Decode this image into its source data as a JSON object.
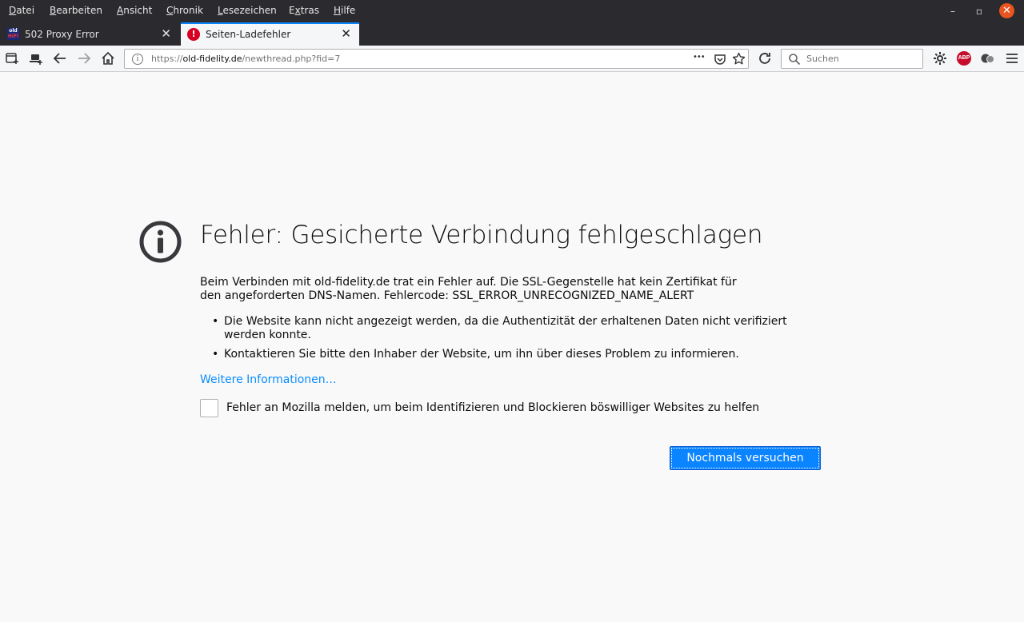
{
  "menubar": {
    "items": [
      {
        "label": "Datei",
        "accel": "D",
        "rest": "atei"
      },
      {
        "label": "Bearbeiten",
        "accel": "B",
        "rest": "earbeiten"
      },
      {
        "label": "Ansicht",
        "accel": "A",
        "rest": "nsicht"
      },
      {
        "label": "Chronik",
        "accel": "C",
        "rest": "hronik"
      },
      {
        "label": "Lesezeichen",
        "accel": "L",
        "rest": "esezeichen"
      },
      {
        "label": "Extras",
        "accel": "x",
        "rest": "tras",
        "prefix": "E"
      },
      {
        "label": "Hilfe",
        "accel": "H",
        "rest": "ilfe"
      }
    ]
  },
  "window_controls": {
    "minimize": "–",
    "restore": "▫",
    "close": "✕"
  },
  "tabs": [
    {
      "title": "502 Proxy Error",
      "favicon_top": "old",
      "favicon_bottom": "HiFi",
      "close": "✕"
    },
    {
      "title": "Seiten-Ladefehler",
      "favicon": "!",
      "close": "✕",
      "active": true
    }
  ],
  "urlbar": {
    "scheme": "https://",
    "host": "old-fidelity.de",
    "path": "/newthread.php?fid=7",
    "info_glyph": "i",
    "page_actions": "•••"
  },
  "searchbar": {
    "placeholder": "Suchen"
  },
  "extensions": {
    "abp_label": "ABP"
  },
  "content": {
    "title": "Fehler: Gesicherte Verbindung fehlgeschlagen",
    "description": "Beim Verbinden mit old-fidelity.de trat ein Fehler auf. Die SSL-Gegenstelle hat kein Zertifikat für den angeforderten DNS-Namen. Fehlercode: SSL_ERROR_UNRECOGNIZED_NAME_ALERT",
    "bullets": [
      "Die Website kann nicht angezeigt werden, da die Authentizität der erhaltenen Daten nicht verifiziert werden konnte.",
      "Kontaktieren Sie bitte den Inhaber der Website, um ihn über dieses Problem zu informieren."
    ],
    "learn_more": "Weitere Informationen…",
    "report_label": "Fehler an Mozilla melden, um beim Identifizieren und Blockieren böswilliger Websites zu helfen",
    "retry_button": "Nochmals versuchen"
  },
  "colors": {
    "accent": "#0a84ff",
    "link": "#0a8dff",
    "chrome_dark": "#2b2a2e",
    "error_favicon": "#d70022",
    "close_orange": "#e95420"
  }
}
